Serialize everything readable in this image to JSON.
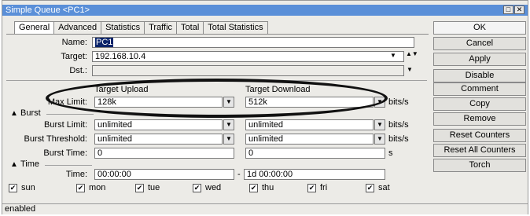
{
  "window": {
    "title": "Simple Queue <PC1>",
    "restore_glyph": "□",
    "close_glyph": "✕"
  },
  "tabs": [
    "General",
    "Advanced",
    "Statistics",
    "Traffic",
    "Total",
    "Total Statistics"
  ],
  "form": {
    "name_label": "Name:",
    "name_value": "PC1",
    "target_label": "Target:",
    "target_value": "192.168.10.4",
    "dst_label": "Dst.:",
    "dst_value": "",
    "target_upload_header": "Target Upload",
    "target_download_header": "Target Download",
    "max_limit_label": "Max Limit:",
    "max_limit_upload": "128k",
    "max_limit_download": "512k",
    "bits_unit": "bits/s",
    "burst_group": "Burst",
    "burst_limit_label": "Burst Limit:",
    "burst_limit_upload": "unlimited",
    "burst_limit_download": "unlimited",
    "burst_threshold_label": "Burst Threshold:",
    "burst_threshold_upload": "unlimited",
    "burst_threshold_download": "unlimited",
    "burst_time_label": "Burst Time:",
    "burst_time_upload": "0",
    "burst_time_download": "0",
    "seconds_unit": "s",
    "time_group": "Time",
    "time_label": "Time:",
    "time_start": "00:00:00",
    "time_dash": "-",
    "time_end": "1d 00:00:00",
    "days": [
      {
        "label": "sun",
        "checked": true
      },
      {
        "label": "mon",
        "checked": true
      },
      {
        "label": "tue",
        "checked": true
      },
      {
        "label": "wed",
        "checked": true
      },
      {
        "label": "thu",
        "checked": true
      },
      {
        "label": "fri",
        "checked": true
      },
      {
        "label": "sat",
        "checked": true
      }
    ]
  },
  "buttons": {
    "ok": "OK",
    "cancel": "Cancel",
    "apply": "Apply",
    "disable": "Disable",
    "comment": "Comment",
    "copy": "Copy",
    "remove": "Remove",
    "reset_counters": "Reset Counters",
    "reset_all_counters": "Reset All Counters",
    "torch": "Torch"
  },
  "status": "enabled",
  "icons": {
    "dropdown": "▼",
    "updown": "▲▼",
    "collapse": "▲",
    "check": "✔"
  }
}
